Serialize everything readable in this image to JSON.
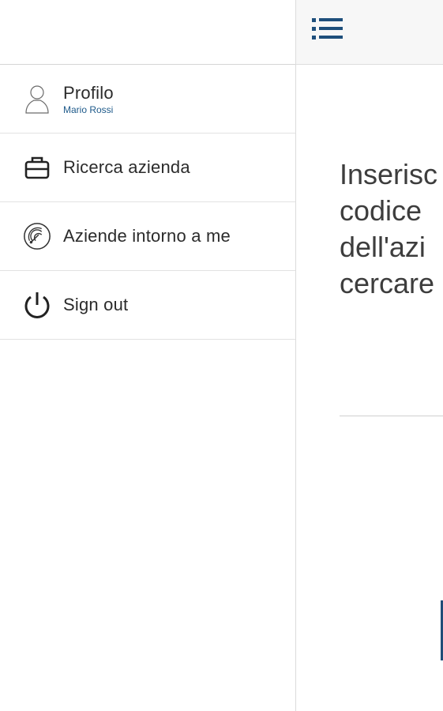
{
  "drawer": {
    "items": [
      {
        "label": "Profilo",
        "sublabel": "Mario Rossi",
        "icon": "user-icon"
      },
      {
        "label": "Ricerca azienda",
        "icon": "briefcase-icon"
      },
      {
        "label": "Aziende intorno a me",
        "icon": "radar-icon"
      },
      {
        "label": "Sign out",
        "icon": "power-icon"
      }
    ]
  },
  "main": {
    "menu_icon": "hamburger-list-icon",
    "instruction": "Inserisc\ncodice\ndell'azi\ncercare",
    "code_input_value": ""
  },
  "colors": {
    "accent": "#1e5a8a",
    "button": "#1f4d78",
    "text": "#2b2b2b"
  }
}
